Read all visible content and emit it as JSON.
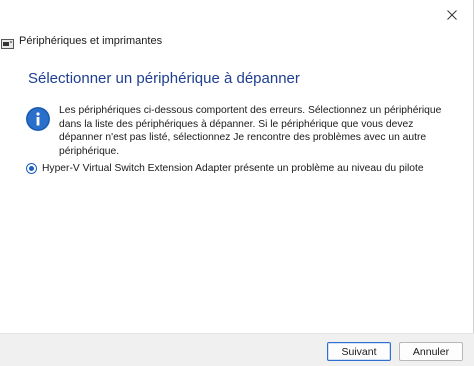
{
  "window": {
    "title": "Périphériques et imprimantes",
    "close_icon": "close-icon"
  },
  "main": {
    "heading": "Sélectionner un périphérique à dépanner",
    "info_icon": "info-icon",
    "info_text": "Les périphériques ci-dessous comportent des erreurs. Sélectionnez un périphérique dans la liste des périphériques à dépanner. Si le périphérique que vous devez dépanner n'est pas listé, sélectionnez Je rencontre des problèmes avec un autre périphérique.",
    "options": [
      {
        "label": "Hyper-V Virtual Switch Extension Adapter présente un problème au niveau du pilote",
        "selected": true
      }
    ]
  },
  "footer": {
    "next_label": "Suivant",
    "cancel_label": "Annuler"
  },
  "colors": {
    "heading": "#1e3f8f",
    "accent": "#2a6fc9",
    "footer_bg": "#f0f0f0"
  }
}
